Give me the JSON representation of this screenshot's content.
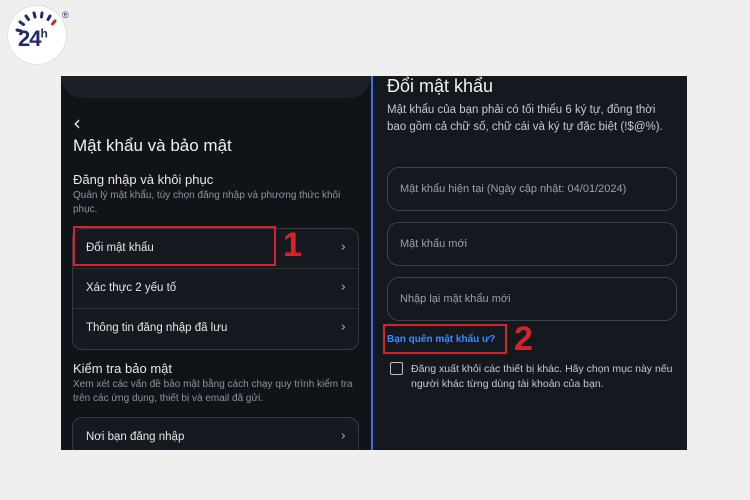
{
  "logo": {
    "text": "24",
    "superscript": "h",
    "registered": "®"
  },
  "left": {
    "back_icon": "back-chevron-icon",
    "title": "Mật khẩu và bảo mật",
    "login_section": {
      "title": "Đăng nhập và khôi phục",
      "description": "Quản lý mật khẩu, tùy chọn đăng nhập và phương thức khôi phục.",
      "items": [
        {
          "label": "Đổi mật khẩu"
        },
        {
          "label": "Xác thực 2 yếu tố"
        },
        {
          "label": "Thông tin đăng nhập đã lưu"
        }
      ]
    },
    "security_section": {
      "title": "Kiểm tra bảo mật",
      "description": "Xem xét các vấn đề bảo mật bằng cách chạy quy trình kiểm tra trên các ứng dụng, thiết bị và email đã gửi.",
      "items": [
        {
          "label": "Nơi bạn đăng nhập"
        }
      ]
    },
    "step_number": "1"
  },
  "right": {
    "title": "Đổi mật khẩu",
    "description": "Mật khẩu của bạn phải có tối thiểu 6 ký tự, đồng thời bao gồm cả chữ số, chữ cái và ký tự đặc biệt (!$@%).",
    "fields": {
      "current_placeholder": "Mật khẩu hiện tại (Ngày cập nhật: 04/01/2024)",
      "new_placeholder": "Mật khẩu mới",
      "confirm_placeholder": "Nhập lại mật khẩu mới"
    },
    "forgot_link": "Bạn quên mật khẩu ư?",
    "logout_checkbox_label": "Đăng xuất khỏi các thiết bị khác. Hãy chọn mục này nếu người khác từng dùng tài khoản của bạn.",
    "step_number": "2"
  },
  "colors": {
    "highlight": "#d6232a",
    "link": "#3a8bff",
    "divider": "#3b6fe0",
    "panel_bg": "#101318"
  }
}
